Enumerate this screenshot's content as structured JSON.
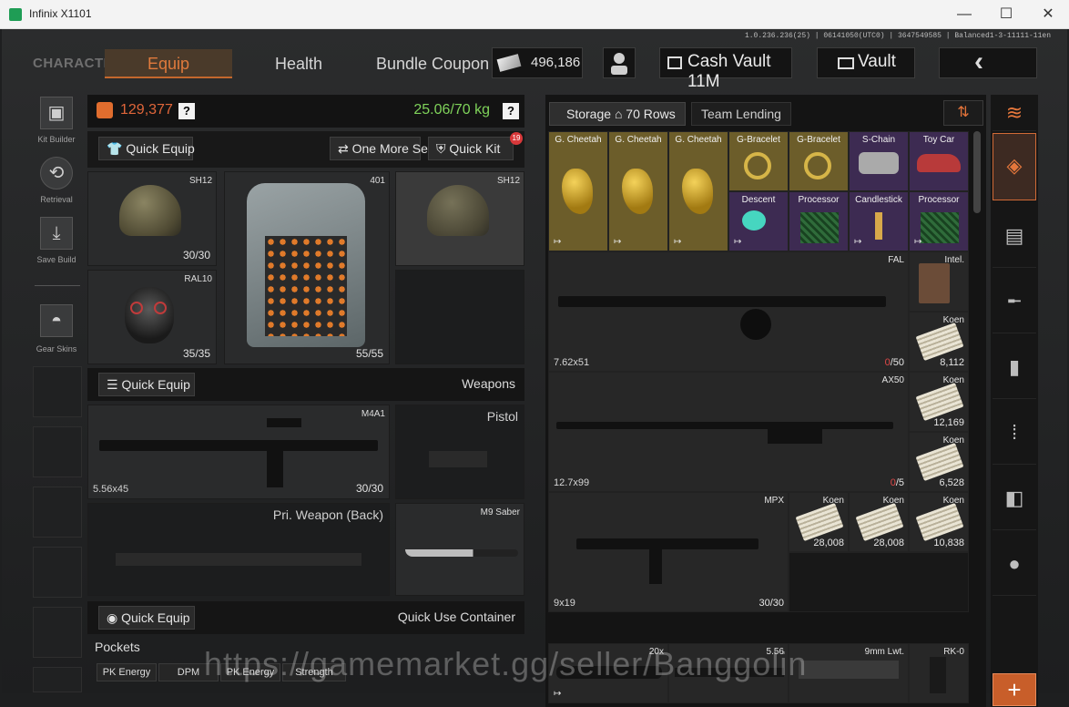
{
  "window": {
    "title": "Infinix X1101",
    "controls": {
      "minimize": "—",
      "maximize": "☐",
      "close": "✕"
    }
  },
  "version_info": "1.0.236.236(25) | 06141050(UTC0) | 3647549585 | Balanced1-3-11111-11en",
  "nav": {
    "character": "CHARACTER",
    "equip": "Equip",
    "health": "Health",
    "bundle_coupon": "Bundle Coupon"
  },
  "currency": {
    "cash": "496,186",
    "cash_vault": "Cash Vault 11M",
    "vault": "Vault"
  },
  "sidebar": {
    "kit_builder": "Kit Builder",
    "retrieval": "Retrieval",
    "save_build": "Save Build",
    "gear_skins": "Gear Skins"
  },
  "equip": {
    "value": "129,377",
    "weight": "25.06/70 kg",
    "help": "?",
    "quick_equip": "Quick Equip",
    "one_more_set": "One More Set",
    "quick_kit": "Quick Kit",
    "quick_kit_badge": "19",
    "helmet": {
      "name": "SH12",
      "durability": "30/30"
    },
    "armor": {
      "name": "401",
      "durability": "55/55"
    },
    "helmet_alt": {
      "name": "SH12"
    },
    "mask": {
      "name": "RAL10",
      "durability": "35/35"
    }
  },
  "weapons": {
    "quick_equip": "Quick Equip",
    "title": "Weapons",
    "primary": {
      "name": "M4A1",
      "ammo": "5.56x45",
      "count": "30/30"
    },
    "pistol": "Pistol",
    "back": "Pri. Weapon (Back)",
    "melee": "M9 Saber"
  },
  "container": {
    "quick_equip": "Quick Equip",
    "title": "Quick Use Container",
    "pockets": "Pockets",
    "pocket_items": [
      "PK Energy",
      "DPM",
      "PK Energy",
      "Strength"
    ]
  },
  "storage": {
    "tab_storage": "Storage",
    "rows": "70 Rows",
    "tab_lending": "Team Lending",
    "row1": [
      "G. Cheetah",
      "G. Cheetah",
      "G. Cheetah",
      "G-Bracelet",
      "G-Bracelet",
      "S-Chain",
      "Toy Car"
    ],
    "row2": [
      "Descent",
      "Processor",
      "Candlestick",
      "Processor"
    ],
    "fal": {
      "name": "FAL",
      "ammo": "7.62x51",
      "count_zero": "0",
      "count_max": "/50"
    },
    "intel": "Intel.",
    "koen1": {
      "name": "Koen",
      "value": "8,112"
    },
    "ax50": {
      "name": "AX50",
      "ammo": "12.7x99",
      "count_zero": "0",
      "count_max": "/5"
    },
    "koen2": {
      "name": "Koen",
      "value": "12,169"
    },
    "koen3": {
      "name": "Koen",
      "value": "6,528"
    },
    "mpx": {
      "name": "MPX",
      "ammo": "9x19",
      "count": "30/30"
    },
    "koen4": {
      "name": "Koen",
      "value": "28,008"
    },
    "koen5": {
      "name": "Koen",
      "value": "28,008"
    },
    "koen6": {
      "name": "Koen",
      "value": "10,838"
    },
    "bottom": [
      "20x",
      "5.56",
      "9mm Lwt.",
      "RK-0"
    ]
  },
  "add_label": "+",
  "watermark": "https://gamemarket.gg/seller/Banggolin"
}
